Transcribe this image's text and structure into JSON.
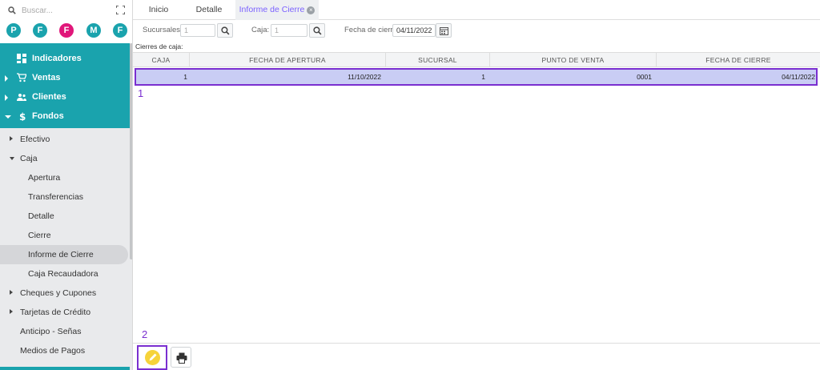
{
  "sidebar": {
    "search_placeholder": "Buscar...",
    "avatars": [
      {
        "letter": "P",
        "color": "#1aa3ad"
      },
      {
        "letter": "F",
        "color": "#1aa3ad"
      },
      {
        "letter": "F",
        "color": "#e0177a"
      },
      {
        "letter": "M",
        "color": "#1aa3ad"
      },
      {
        "letter": "F",
        "color": "#1aa3ad"
      }
    ],
    "main_items": [
      {
        "label": "Indicadores",
        "icon": "dashboard-icon"
      },
      {
        "label": "Ventas",
        "icon": "cart-icon"
      },
      {
        "label": "Clientes",
        "icon": "users-icon"
      },
      {
        "label": "Fondos",
        "icon": "dollar-icon"
      }
    ],
    "fondos_items": [
      {
        "label": "Efectivo"
      },
      {
        "label": "Caja"
      },
      {
        "label": "Apertura"
      },
      {
        "label": "Transferencias"
      },
      {
        "label": "Detalle"
      },
      {
        "label": "Cierre"
      },
      {
        "label": "Informe de Cierre"
      },
      {
        "label": "Caja Recaudadora"
      },
      {
        "label": "Cheques y Cupones"
      },
      {
        "label": "Tarjetas de Crédito"
      },
      {
        "label": "Anticipo - Señas"
      },
      {
        "label": "Medios de Pagos"
      }
    ]
  },
  "tabs": [
    {
      "label": "Inicio"
    },
    {
      "label": "Detalle"
    },
    {
      "label": "Informe de Cierre",
      "active": true
    }
  ],
  "filters": {
    "sucursales_label": "Sucursales",
    "sucursales_value": "1",
    "caja_label": "Caja:",
    "caja_value": "1",
    "fecha_label": "Fecha de cierre",
    "fecha_value": "04/11/2022"
  },
  "grid": {
    "caption": "Cierres de caja:",
    "columns": [
      "CAJA",
      "FECHA DE APERTURA",
      "SUCURSAL",
      "PUNTO DE VENTA",
      "FECHA DE CIERRE"
    ],
    "rows": [
      [
        "1",
        "11/10/2022",
        "1",
        "0001",
        "04/11/2022"
      ]
    ]
  },
  "annotations": {
    "one": "1",
    "two": "2"
  },
  "colors": {
    "accent": "#1aa3ad",
    "highlight": "#7a2fd0",
    "edit": "#f6d33a"
  }
}
